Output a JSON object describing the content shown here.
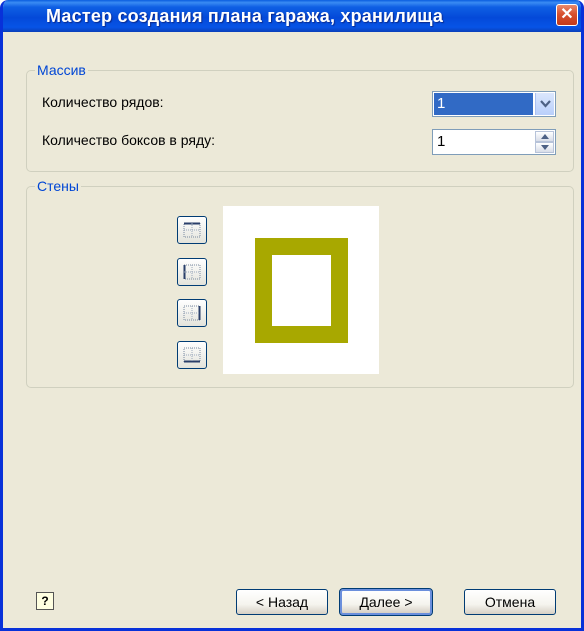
{
  "window": {
    "title": "Мастер создания плана гаража, хранилища",
    "close_glyph": "✕"
  },
  "array_group": {
    "legend": "Массив",
    "rows_label": "Количество рядов:",
    "rows_value": "1",
    "boxes_label": "Количество боксов в ряду:",
    "boxes_value": "1"
  },
  "walls_group": {
    "legend": "Стены",
    "buttons": [
      {
        "icon": "wall-top-icon"
      },
      {
        "icon": "wall-left-icon"
      },
      {
        "icon": "wall-right-icon"
      },
      {
        "icon": "wall-bottom-icon"
      }
    ],
    "preview_wall_color": "#a8a800"
  },
  "footer": {
    "help_glyph": "?",
    "back_label": "< Назад",
    "next_label": "Далее >",
    "cancel_label": "Отмена"
  }
}
